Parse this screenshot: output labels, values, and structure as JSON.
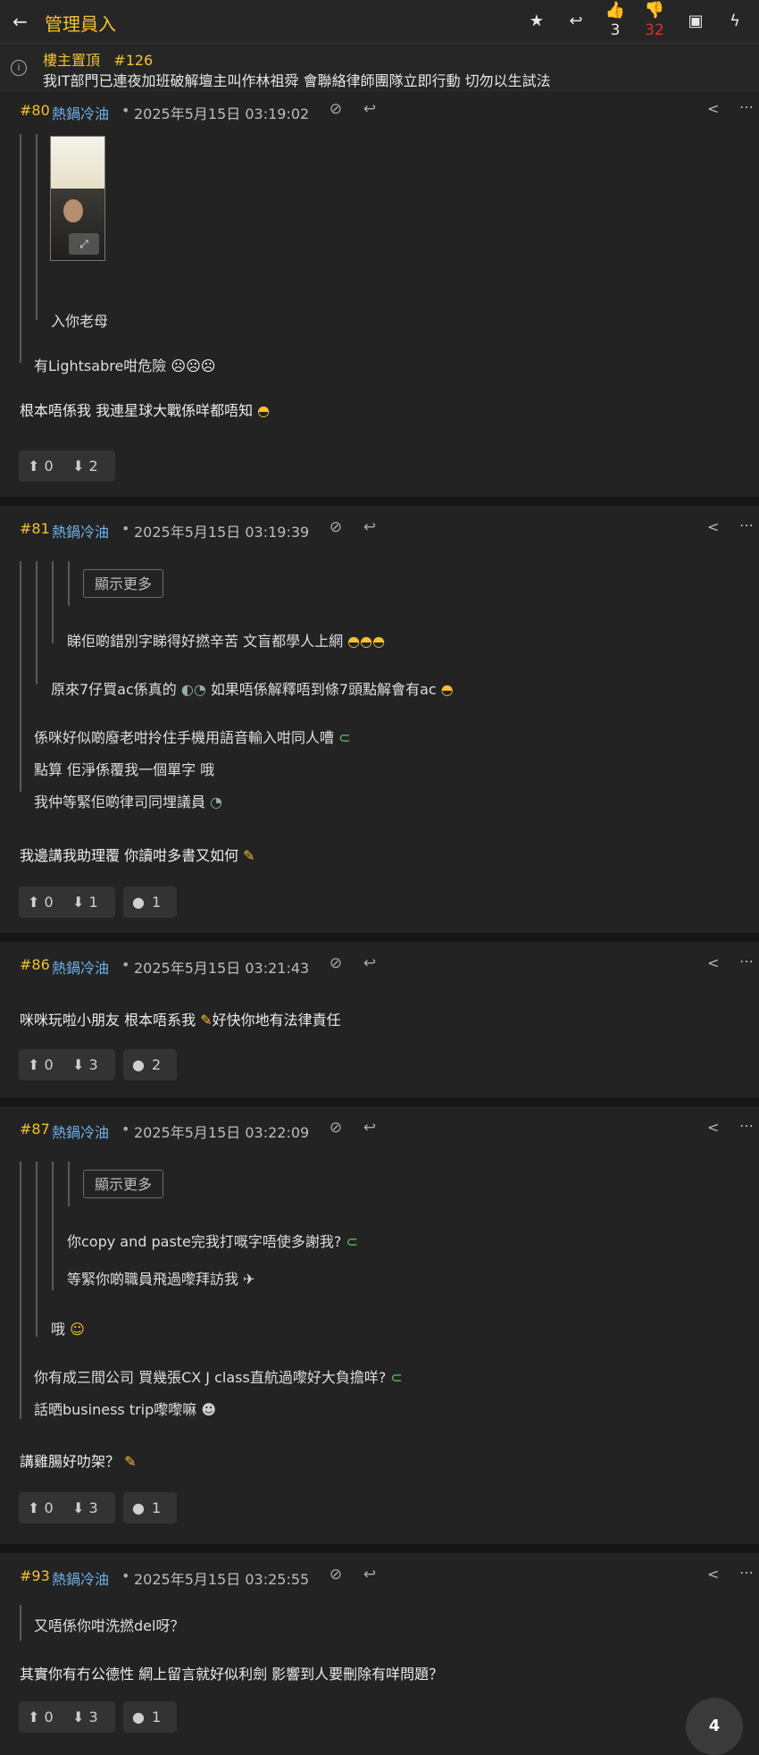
{
  "topbar": {
    "title": "管理員入",
    "likes": "3",
    "dislikes": "32"
  },
  "pinned": {
    "label": "樓主置頂",
    "ref": "#126",
    "text": "我IT部門已連夜加班破解壇主叫作林祖舜 會聯絡律師團隊立即行動 切勿以生試法"
  },
  "posts": [
    {
      "num": "#80",
      "user": "熱鍋冷油",
      "time": "2025年5月15日 03:19:02",
      "q2": "入你老母",
      "q1": "有Lightsabre咁危險",
      "main": "根本唔係我 我連星球大戰係咩都唔知",
      "up": "0",
      "down": "2"
    },
    {
      "num": "#81",
      "user": "熱鍋冷油",
      "time": "2025年5月15日 03:19:39",
      "showmore": "顯示更多",
      "q3": "睇佢啲錯別字睇得好撚辛苦 文盲都學人上網",
      "q2": "原來7仔買ac係真的",
      "q2b": "如果唔係解釋唔到條7頭點解會有ac",
      "q1a": "係咪好似啲廢老咁拎住手機用語音輸入咁同人嘈",
      "q1b": "點算 佢淨係覆我一個單字 哦",
      "q1c": "我仲等緊佢啲律司同埋議員",
      "main": "我邊講我助理覆 你讀咁多書又如何",
      "up": "0",
      "down": "1",
      "replies": "1"
    },
    {
      "num": "#86",
      "user": "熱鍋冷油",
      "time": "2025年5月15日 03:21:43",
      "main_a": "咪咪玩啦小朋友 根本唔系我",
      "main_b": "好快你地有法律責任",
      "up": "0",
      "down": "3",
      "replies": "2"
    },
    {
      "num": "#87",
      "user": "熱鍋冷油",
      "time": "2025年5月15日 03:22:09",
      "showmore": "顯示更多",
      "q3a": "你copy and paste完我打嘅字唔使多謝我?",
      "q3b": "等緊你啲職員飛過嚟拜訪我",
      "q2": "哦",
      "q1a": "你有成三間公司 買幾張CX J class直航過嚟好大負擔咩?",
      "q1b": "話晒business trip嚟嚟嘛",
      "main": "講雞腸好叻架？",
      "up": "0",
      "down": "3",
      "replies": "1"
    },
    {
      "num": "#93",
      "user": "熱鍋冷油",
      "time": "2025年5月15日 03:25:55",
      "q1": "又唔係你咁洗撚del呀？",
      "main": "其實你有冇公德性 網上留言就好似利劍 影響到人要刪除有咩問題？",
      "up": "0",
      "down": "3",
      "replies": "1"
    }
  ],
  "pager": "4"
}
